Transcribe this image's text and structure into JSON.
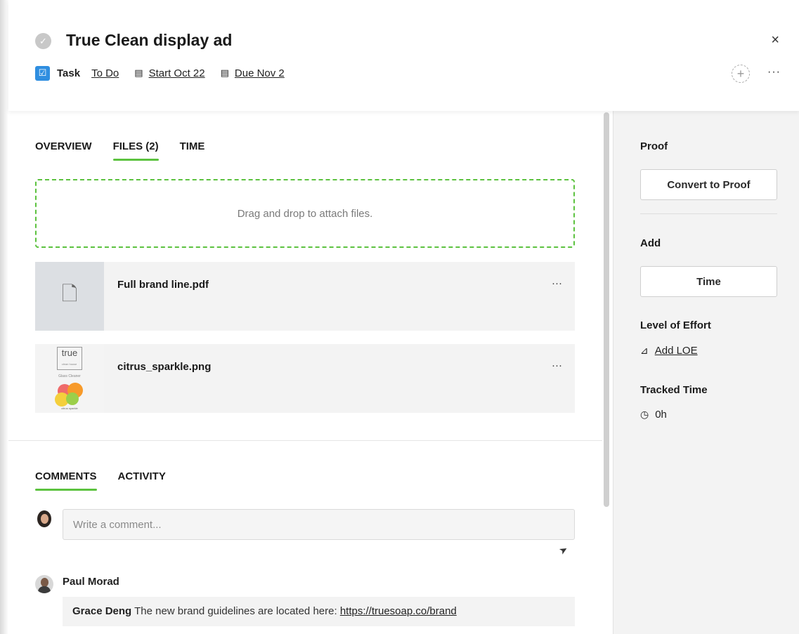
{
  "header": {
    "title": "True Clean display ad",
    "type_label": "Task",
    "status": "To Do",
    "start": "Start Oct 22",
    "due": "Due Nov 2",
    "close_glyph": "×",
    "more_glyph": "···"
  },
  "tabs": [
    "OVERVIEW",
    "FILES (2)",
    "TIME"
  ],
  "dropzone_text": "Drag and drop to attach files.",
  "files": [
    {
      "name": "Full brand line.pdf",
      "icon": "file-icon"
    },
    {
      "name": "citrus_sparkle.png",
      "thumb_logo": "true",
      "thumb_logo_sub": "clean house",
      "thumb_caption": "Glass Cleaner",
      "thumb_caption2": "citrus sparkle"
    }
  ],
  "comment_tabs": [
    "COMMENTS",
    "ACTIVITY"
  ],
  "comment_input": {
    "placeholder": "Write a comment..."
  },
  "comments": [
    {
      "author": "Paul Morad",
      "mention": "Grace Deng",
      "text": "The new brand guidelines are located here:",
      "link": "https://truesoap.co/brand"
    }
  ],
  "sidebar": {
    "proof_label": "Proof",
    "convert_button": "Convert to Proof",
    "add_label": "Add",
    "time_button": "Time",
    "loe_label": "Level of Effort",
    "add_loe": "Add LOE",
    "tracked_label": "Tracked Time",
    "tracked_value": "0h"
  },
  "colors": {
    "accent": "#5cc23f",
    "task_icon": "#2f8ee0",
    "sidebar_bg": "#f3f3f3"
  }
}
